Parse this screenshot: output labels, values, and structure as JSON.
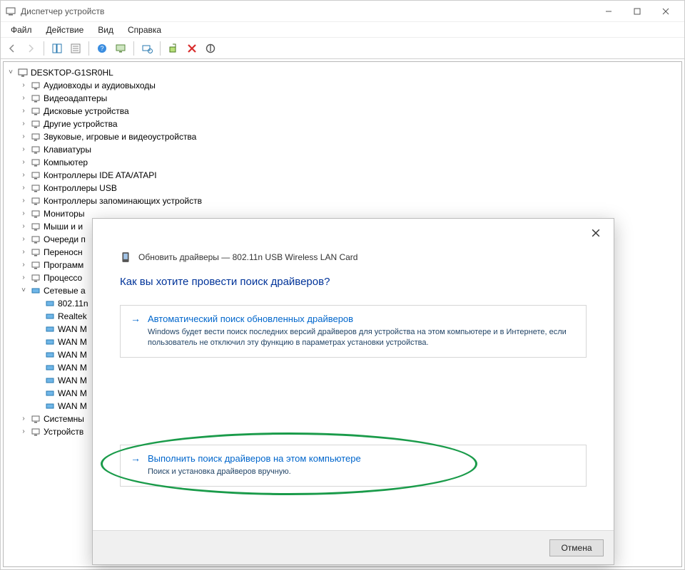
{
  "titlebar": {
    "title": "Диспетчер устройств"
  },
  "menu": {
    "file": "Файл",
    "action": "Действие",
    "view": "Вид",
    "help": "Справка"
  },
  "tree": {
    "root": "DESKTOP-G1SR0HL",
    "items": [
      {
        "label": "Аудиовходы и аудиовыходы"
      },
      {
        "label": "Видеоадаптеры"
      },
      {
        "label": "Дисковые устройства"
      },
      {
        "label": "Другие устройства"
      },
      {
        "label": "Звуковые, игровые и видеоустройства"
      },
      {
        "label": "Клавиатуры"
      },
      {
        "label": "Компьютер"
      },
      {
        "label": "Контроллеры IDE ATA/ATAPI"
      },
      {
        "label": "Контроллеры USB"
      },
      {
        "label": "Контроллеры запоминающих устройств"
      },
      {
        "label": "Мониторы"
      },
      {
        "label": "Мыши и и"
      },
      {
        "label": "Очереди п"
      },
      {
        "label": "Переносн"
      },
      {
        "label": "Программ"
      },
      {
        "label": "Процессо"
      }
    ],
    "network": {
      "label": "Сетевые а",
      "children": [
        {
          "label": "802.11n"
        },
        {
          "label": "Realtek"
        },
        {
          "label": "WAN M"
        },
        {
          "label": "WAN M"
        },
        {
          "label": "WAN M"
        },
        {
          "label": "WAN M"
        },
        {
          "label": "WAN M"
        },
        {
          "label": "WAN M"
        },
        {
          "label": "WAN M"
        }
      ]
    },
    "tail": [
      {
        "label": "Системны"
      },
      {
        "label": "Устройств"
      }
    ]
  },
  "dialog": {
    "breadcrumb": "Обновить драйверы — 802.11n USB Wireless LAN Card",
    "question": "Как вы хотите провести поиск драйверов?",
    "option1": {
      "title": "Автоматический поиск обновленных драйверов",
      "desc": "Windows будет вести поиск последних версий драйверов для устройства на этом компьютере и в Интернете, если пользователь не отключил эту функцию в параметрах установки устройства."
    },
    "option2": {
      "title": "Выполнить поиск драйверов на этом компьютере",
      "desc": "Поиск и установка драйверов вручную."
    },
    "cancel": "Отмена"
  }
}
